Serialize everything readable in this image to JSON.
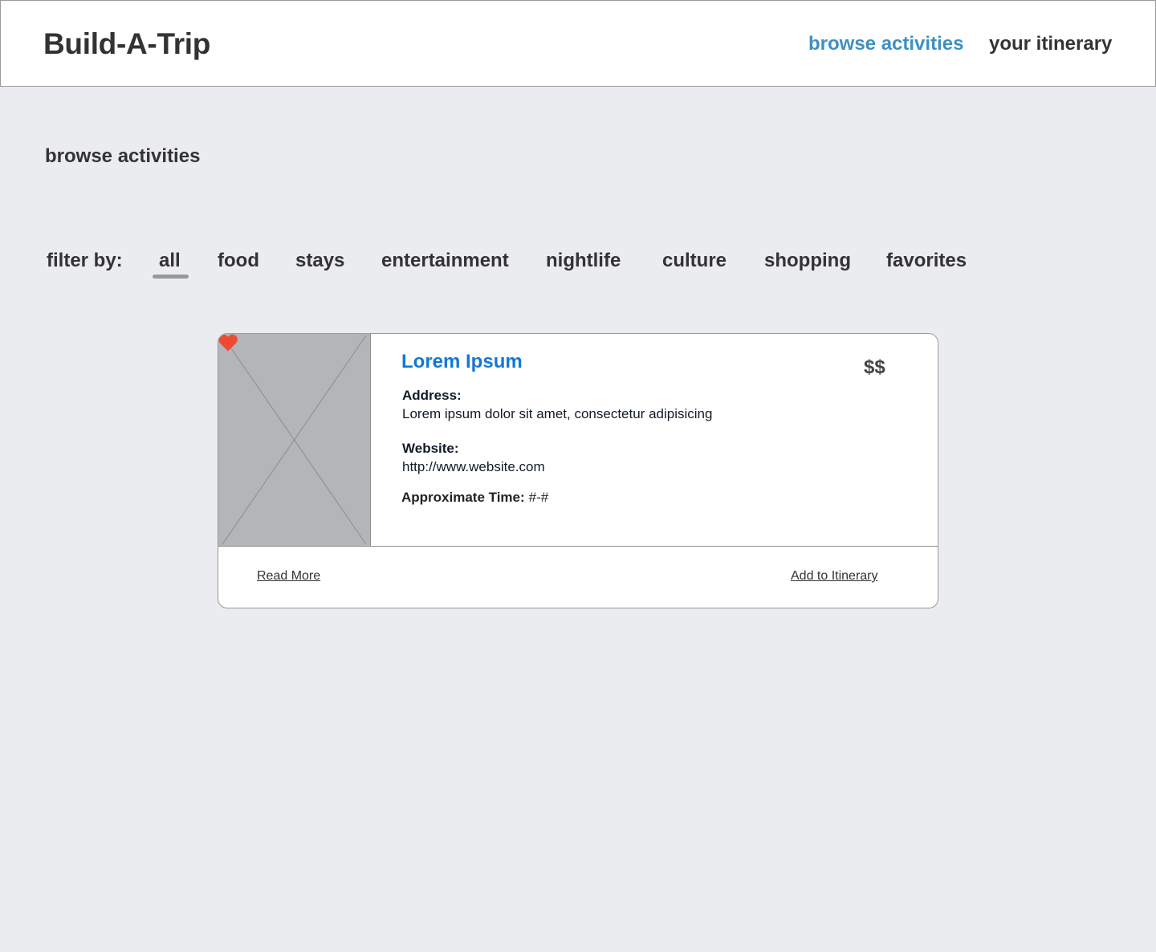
{
  "header": {
    "brand": "Build-A-Trip",
    "nav": {
      "browse": "browse activities",
      "itinerary": "your itinerary"
    }
  },
  "main": {
    "section_title": "browse activities",
    "filter": {
      "label": "filter by:",
      "tabs": [
        "all",
        "food",
        "stays",
        "entertainment",
        "nightlife",
        "culture",
        "shopping",
        "favorites"
      ],
      "selected": "all"
    },
    "card": {
      "title": "Lorem Ipsum",
      "price": "$$",
      "address_label": "Address:",
      "address": "Lorem ipsum dolor sit amet, consectetur adipisicing",
      "website_label": "Website:",
      "website": "http://www.website.com",
      "time_label": "Approximate Time:",
      "time_value": "#-#",
      "read_more": "Read More",
      "add_itinerary": "Add to Itinerary",
      "favorite_icon": "heart-icon",
      "image_icon": "image-placeholder-icon"
    }
  },
  "colors": {
    "background": "#ebecf0",
    "accent_nav": "#3d8fc4",
    "title_blue": "#1378d6",
    "heart": "#f04a33",
    "placeholder": "#b4b5b9"
  }
}
